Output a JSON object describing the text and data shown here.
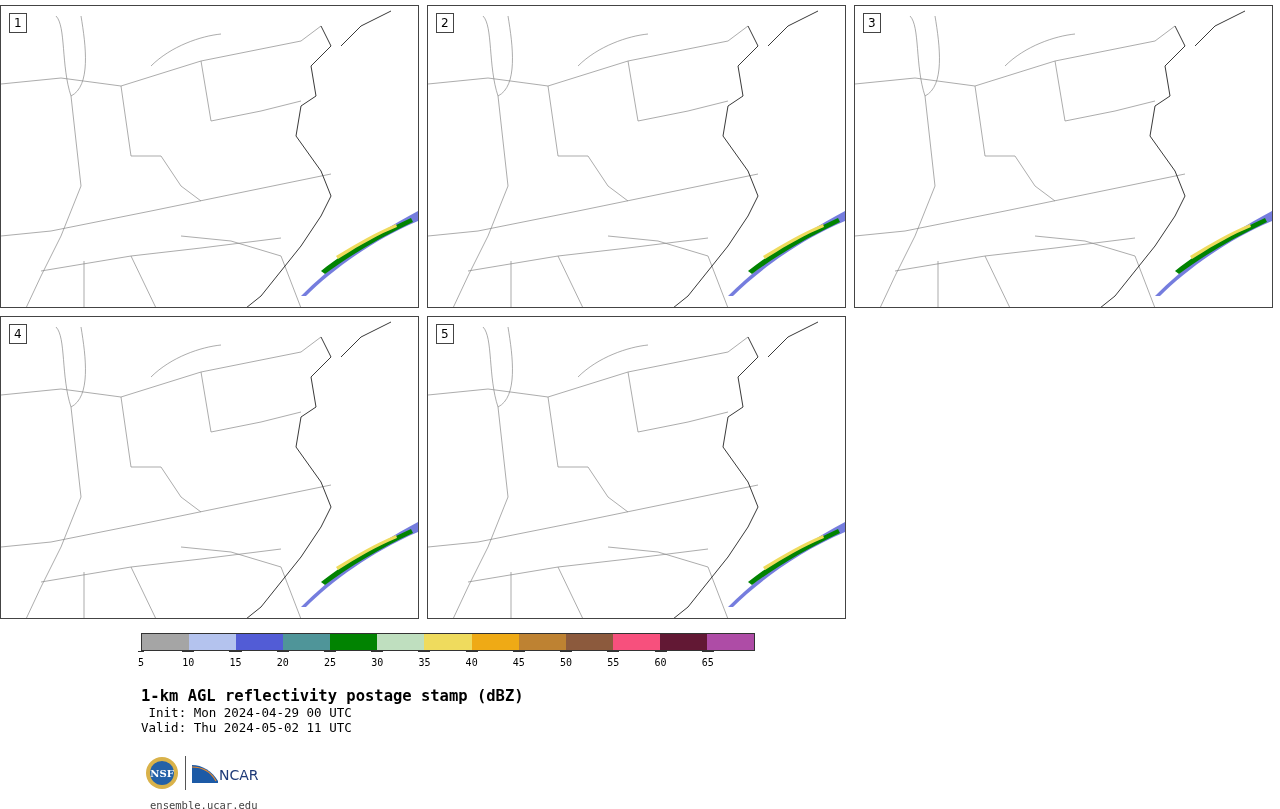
{
  "panels": [
    {
      "number": "1"
    },
    {
      "number": "2"
    },
    {
      "number": "3"
    },
    {
      "number": "4"
    },
    {
      "number": "5"
    }
  ],
  "colorbar": {
    "bins": [
      {
        "label": "5",
        "color": "#a5a5a5"
      },
      {
        "label": "10",
        "color": "#b4c3ee"
      },
      {
        "label": "15",
        "color": "#525cd6"
      },
      {
        "label": "20",
        "color": "#4f9599"
      },
      {
        "label": "25",
        "color": "#018301"
      },
      {
        "label": "30",
        "color": "#bfdfbf"
      },
      {
        "label": "35",
        "color": "#efdb5d"
      },
      {
        "label": "40",
        "color": "#efaa15"
      },
      {
        "label": "45",
        "color": "#be8232"
      },
      {
        "label": "50",
        "color": "#8c5a3d"
      },
      {
        "label": "55",
        "color": "#f7507d"
      },
      {
        "label": "60",
        "color": "#621834"
      },
      {
        "label": "65",
        "color": "#ae4ca6"
      }
    ]
  },
  "title": "1-km AGL reflectivity postage stamp (dBZ)",
  "init": " Init: Mon 2024-04-29 00 UTC",
  "valid": "Valid: Thu 2024-05-02 11 UTC",
  "logos": {
    "nsf": "NSF",
    "ncar": "NCAR"
  },
  "site": "ensemble.ucar.edu"
}
